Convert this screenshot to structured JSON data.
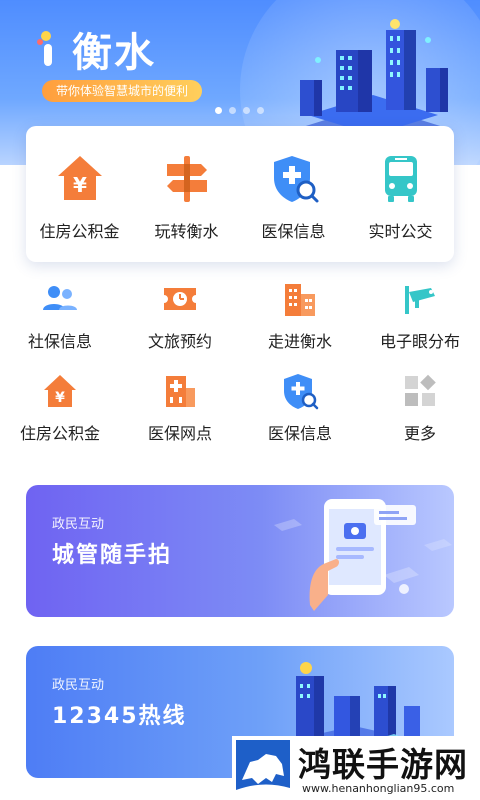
{
  "header": {
    "app_name": "衡水",
    "slogan": "带你体验智慧城市的便利",
    "carousel_dots": 4,
    "carousel_active_index": 0
  },
  "top_services": [
    {
      "label": "住房公积金",
      "icon": "house-yuan-icon"
    },
    {
      "label": "玩转衡水",
      "icon": "signpost-icon"
    },
    {
      "label": "医保信息",
      "icon": "medical-shield-search-icon"
    },
    {
      "label": "实时公交",
      "icon": "bus-icon"
    }
  ],
  "services": [
    {
      "label": "社保信息",
      "icon": "users-icon"
    },
    {
      "label": "文旅预约",
      "icon": "ticket-clock-icon"
    },
    {
      "label": "走进衡水",
      "icon": "buildings-icon"
    },
    {
      "label": "电子眼分布",
      "icon": "cctv-camera-icon"
    },
    {
      "label": "住房公积金",
      "icon": "house-yuan-icon"
    },
    {
      "label": "医保网点",
      "icon": "hospital-icon"
    },
    {
      "label": "医保信息",
      "icon": "medical-shield-search-icon"
    },
    {
      "label": "更多",
      "icon": "grid-more-icon"
    }
  ],
  "banners": [
    {
      "subtitle": "政民互动",
      "title": "城管随手拍"
    },
    {
      "subtitle": "政民互动",
      "title": "12345热线"
    }
  ],
  "watermark": {
    "title": "鸿联手游网",
    "url": "www.henanhonglian95.com"
  },
  "colors": {
    "accent_orange": "#f47d3a",
    "accent_blue": "#3f8ef7",
    "accent_teal": "#35c6c8",
    "hero_blue": "#4f8dff"
  }
}
